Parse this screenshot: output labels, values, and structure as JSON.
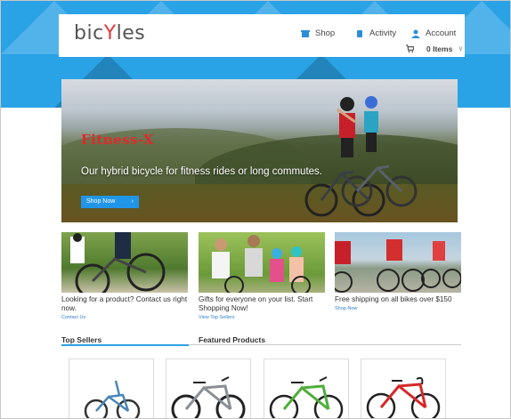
{
  "header": {
    "logo_prefix": "bic",
    "logo_mid": "Y",
    "logo_suffix": "les",
    "nav": [
      {
        "label": "Shop",
        "icon": "storefront-icon"
      },
      {
        "label": "Activity",
        "icon": "activity-icon"
      },
      {
        "label": "Account",
        "icon": "user-icon"
      }
    ],
    "cart_count": "0",
    "cart_label": "Items"
  },
  "hero": {
    "title": "Fitness-X",
    "text": "Our hybrid bicycle for fitness rides or long commutes.",
    "button": "Shop Now"
  },
  "promos": [
    {
      "title": "Looking for a product? Contact us right now.",
      "link": "Contact Us"
    },
    {
      "title": "Gifts for everyone on your list. Start Shopping Now!",
      "link": "View Top Sellers"
    },
    {
      "title": "Free shipping on all bikes over $150",
      "link": "Shop Now"
    }
  ],
  "tabs": {
    "left": "Top Sellers",
    "right": "Featured Products"
  },
  "colors": {
    "brand_blue": "#2aa2e6",
    "accent_red": "#e23b3b",
    "link_blue": "#2f7fd1",
    "tab_underline": "#2aa2e6"
  }
}
